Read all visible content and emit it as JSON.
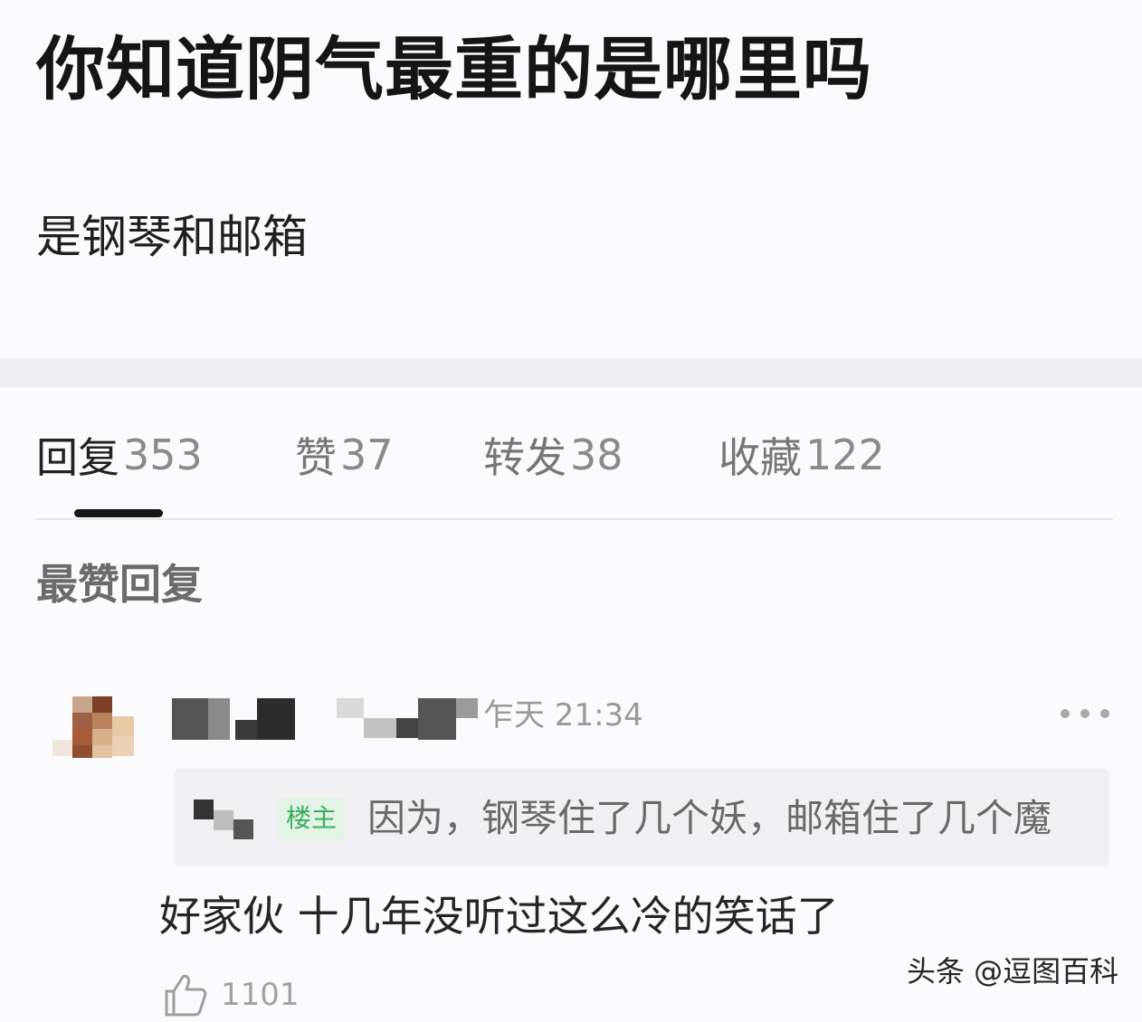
{
  "post": {
    "title": "你知道阴气最重的是哪里吗",
    "body": "是钢琴和邮箱"
  },
  "tabs": [
    {
      "label": "回复",
      "count": "353",
      "active": true
    },
    {
      "label": "赞",
      "count": "37",
      "active": false
    },
    {
      "label": "转发",
      "count": "38",
      "active": false
    },
    {
      "label": "收藏",
      "count": "122",
      "active": false
    }
  ],
  "section": {
    "heading": "最赞回复"
  },
  "comment": {
    "timestamp": "乍天 21:34",
    "quote": {
      "badge": "楼主",
      "text": "因为，钢琴住了几个妖，邮箱住了几个魔"
    },
    "text": "好家伙 十几年没听过这么冷的笑话了",
    "likes": "1101"
  },
  "watermark": "头条 @逗图百科",
  "colors": {
    "accent": "#161616",
    "op_badge_bg": "#e3f4e6",
    "op_badge_text": "#3aae5c"
  },
  "icons": {
    "more": "more-dots-icon",
    "like": "thumbs-up-icon"
  }
}
